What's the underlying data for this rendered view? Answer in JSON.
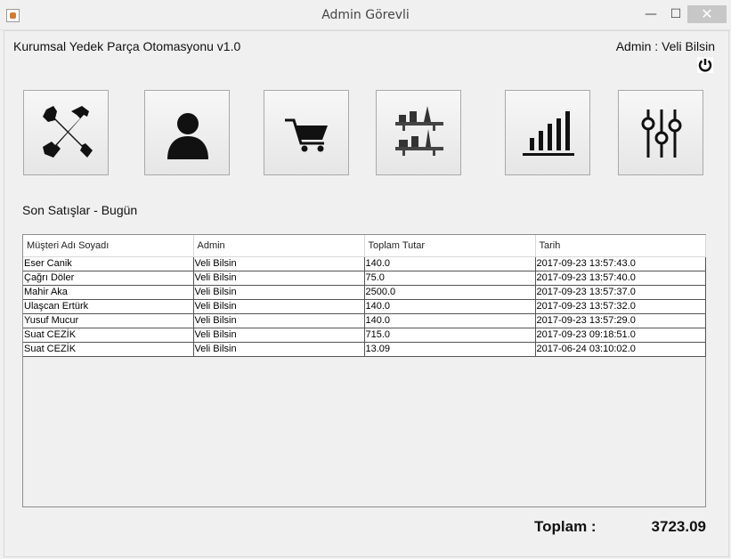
{
  "window": {
    "title": "Admin Görevli",
    "minimize": "—",
    "maximize": "☐",
    "close": "✕"
  },
  "header": {
    "app_title": "Kurumsal Yedek Parça Otomasyonu v1.0",
    "user": "Admin : Veli Bilsin"
  },
  "toolbar": {
    "icons": [
      "tools-icon",
      "user-icon",
      "cart-icon",
      "shelves-icon",
      "bar-chart-icon",
      "sliders-icon"
    ]
  },
  "sales": {
    "title": "Son Satışlar - Bugün",
    "columns": [
      "Müşteri Adı Soyadı",
      "Admin",
      "Toplam Tutar",
      "Tarih"
    ],
    "rows": [
      [
        "Eser Canik",
        "Veli Bilsin",
        "140.0",
        "2017-09-23 13:57:43.0"
      ],
      [
        "Çağrı Döler",
        "Veli Bilsin",
        "75.0",
        "2017-09-23 13:57:40.0"
      ],
      [
        "Mahir Aka",
        "Veli Bilsin",
        "2500.0",
        "2017-09-23 13:57:37.0"
      ],
      [
        "Ulaşcan Ertürk",
        "Veli Bilsin",
        "140.0",
        "2017-09-23 13:57:32.0"
      ],
      [
        "Yusuf Mucur",
        "Veli Bilsin",
        "140.0",
        "2017-09-23 13:57:29.0"
      ],
      [
        "Suat CEZİK",
        "Veli Bilsin",
        "715.0",
        "2017-09-23 09:18:51.0"
      ],
      [
        "Suat CEZİK",
        "Veli Bilsin",
        "13.09",
        "2017-06-24 03:10:02.0"
      ]
    ]
  },
  "footer": {
    "total_label": "Toplam :",
    "total_value": "3723.09"
  }
}
